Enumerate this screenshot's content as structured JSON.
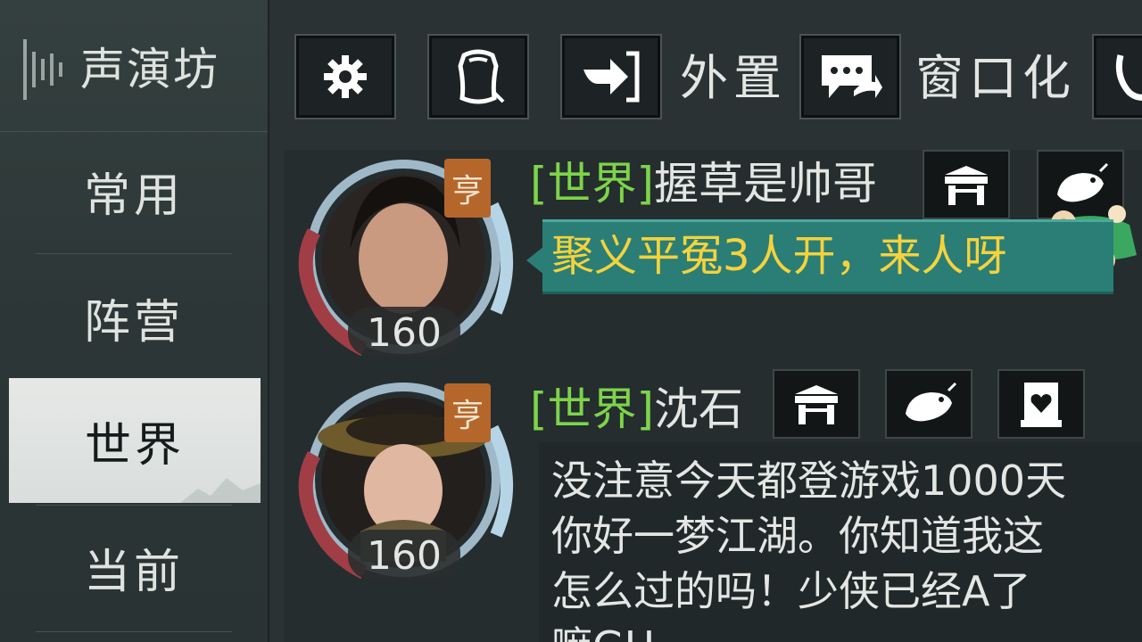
{
  "sidebar": {
    "header_label": "声演坊",
    "items": [
      {
        "label": "常用"
      },
      {
        "label": "阵营"
      },
      {
        "label": "世界",
        "active": true
      },
      {
        "label": "当前"
      }
    ]
  },
  "toolbar": {
    "external_label": "外置",
    "windowed_label": "窗口化"
  },
  "messages": [
    {
      "channel": "[世界]",
      "username": "握草是帅哥",
      "level": "160",
      "badge": "亨",
      "text": "聚义平冤3人开，来人呀"
    },
    {
      "channel": "[世界]",
      "username": "沈石",
      "level": "160",
      "badge": "亨",
      "lines": [
        "没注意今天都登游戏1000天",
        "你好一梦江湖。你知道我这",
        "怎么过的吗！少侠已经A了",
        "嘛GH"
      ]
    }
  ],
  "colors": {
    "channel": "#7dd44a",
    "highlight_text": "#f5d23c",
    "bubble_teal": "#2a7e76",
    "active_tab": "#e6e8e6"
  }
}
